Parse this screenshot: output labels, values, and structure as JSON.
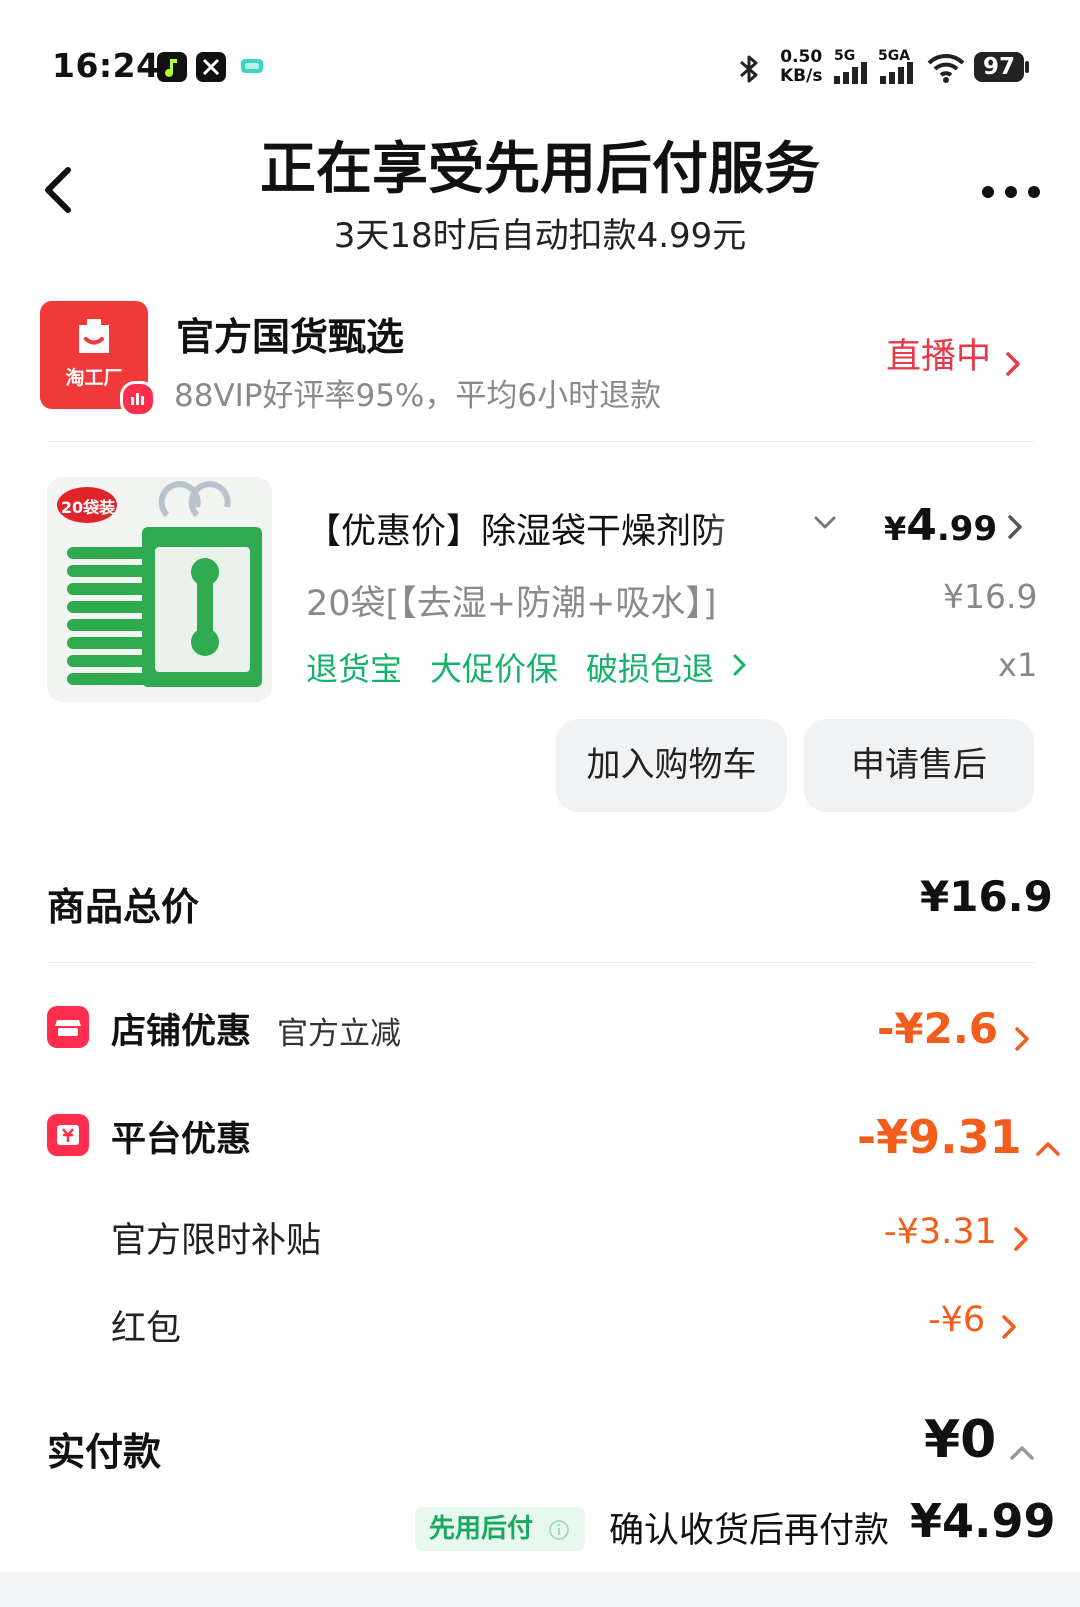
{
  "status_bar": {
    "time": "16:24",
    "apps": [
      {
        "name": "music-app-icon",
        "color": "#111111"
      },
      {
        "name": "x-app-icon",
        "color": "#111111"
      },
      {
        "name": "chat-app-icon",
        "color": "#3fd6c1"
      }
    ],
    "speed_value": "0.50",
    "speed_unit": "KB/s",
    "network1": "5G",
    "network2": "5GA",
    "battery": "97"
  },
  "header": {
    "title": "正在享受先用后付服务",
    "subtitle": "3天18时后自动扣款4.99元"
  },
  "store": {
    "logo_text": "淘工厂",
    "name": "官方国货甄选",
    "rating": "88VIP好评率95%，平均6小时退款",
    "live_label": "直播中",
    "brand_color": "#f03a3a"
  },
  "product": {
    "image_badge": "20袋装",
    "title": "【优惠价】除湿袋干燥剂防",
    "price_symbol": "¥",
    "price_int": "4",
    "price_dec": ".99",
    "original_price": "¥16.9",
    "sku": "20袋[【去湿+防潮+吸水】]",
    "services": [
      "退货宝",
      "大促价保",
      "破损包退"
    ],
    "quantity": "x1",
    "buttons": {
      "add_cart": "加入购物车",
      "after_sale": "申请售后"
    }
  },
  "summary": {
    "total_label": "商品总价",
    "total_value": "¥16.9",
    "store_discount_label": "店铺优惠",
    "store_discount_desc": "官方立减",
    "store_discount_value": "-¥2.6",
    "platform_discount_label": "平台优惠",
    "platform_discount_value": "-¥9.31",
    "platform_items": [
      {
        "label": "官方限时补贴",
        "value": "-¥3.31"
      },
      {
        "label": "红包",
        "value": "-¥6"
      }
    ],
    "paid_label": "实付款",
    "paid_value": "¥0",
    "pay_later_tag": "先用后付",
    "pay_later_note": "确认收货后再付款",
    "pay_later_amount": "¥4.99",
    "discount_color": "#f25d1c",
    "service_color": "#17b26a"
  }
}
